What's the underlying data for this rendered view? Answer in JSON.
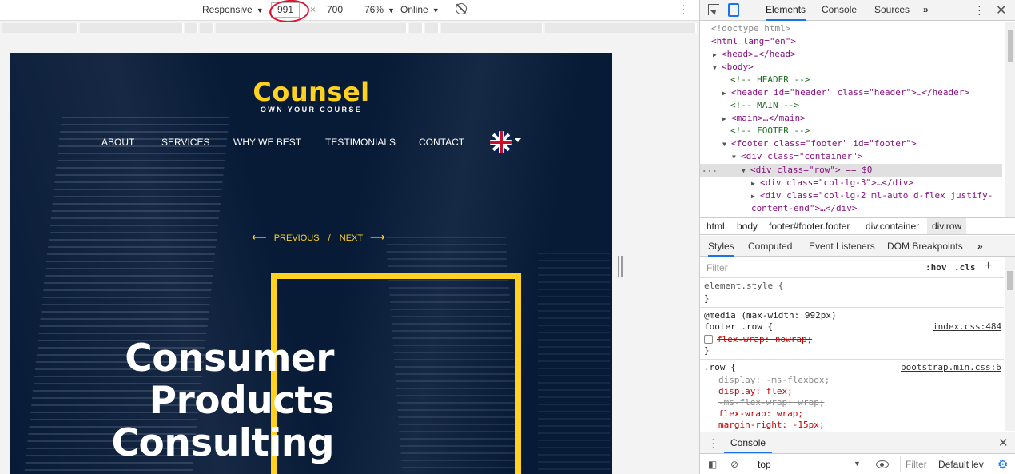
{
  "device_toolbar": {
    "device": "Responsive",
    "width": "991",
    "height": "700",
    "zoom": "76%",
    "throttle": "Online"
  },
  "site": {
    "logo_title": "Counsel",
    "logo_tagline": "OWN YOUR COURSE",
    "nav": [
      "ABOUT",
      "SERVICES",
      "WHY WE BEST",
      "TESTIMONIALS",
      "CONTACT"
    ],
    "pager_prev": "PREVIOUS",
    "pager_sep": "/",
    "pager_next": "NEXT",
    "hero": [
      "Consumer",
      "Products",
      "Consulting"
    ],
    "colors": {
      "accent": "#ffd21f",
      "background": "#071a36"
    }
  },
  "devtools": {
    "tabs": [
      "Elements",
      "Console",
      "Sources",
      "»"
    ],
    "active_tab": "Elements",
    "dom": {
      "doctype": "<!doctype html>",
      "html_open": "<html lang=\"en\">",
      "head": "<head>…</head>",
      "body_open": "<body>",
      "c_header": "<!-- HEADER -->",
      "header": "<header id=\"header\" class=\"header\">…</header>",
      "c_main": "<!-- MAIN -->",
      "main": "<main>…</main>",
      "c_footer": "<!-- FOOTER -->",
      "footer_open": "<footer class=\"footer\" id=\"footer\">",
      "container_open": "<div class=\"container\">",
      "row_open": "<div class=\"row\"> == $0",
      "col3": "<div class=\"col-lg-3\">…</div>",
      "col2_a": "<div class=\"col-lg-2 ml-auto d-flex justify-",
      "col2_b": "content-end\">…</div>",
      "ellipsis": "..."
    },
    "breadcrumbs": [
      "html",
      "body",
      "footer#footer.footer",
      "div.container",
      "div.row"
    ],
    "sub_tabs": [
      "Styles",
      "Computed",
      "Event Listeners",
      "DOM Breakpoints",
      "»"
    ],
    "filter_placeholder": "Filter",
    "hov": ":hov",
    "cls": ".cls",
    "styles": {
      "element_style": "element.style {",
      "close_brace": "}",
      "media": "@media (max-width: 992px)",
      "footer_row": "footer .row {",
      "index_link": "index.css:484",
      "flex_wrap_nowrap": "flex-wrap: nowrap;",
      "row_rule": ".row {",
      "bootstrap_link": "bootstrap.min.css:6",
      "display_ms": "display: -ms-flexbox;",
      "display_flex": "display: flex;",
      "ms_flex_wrap": "-ms-flex-wrap: wrap;",
      "flex_wrap": "flex-wrap: wrap;",
      "margin_right": "margin-right: -15px;"
    },
    "drawer": {
      "tab": "Console",
      "context": "top",
      "filter": "Filter",
      "levels": "Default lev"
    }
  }
}
